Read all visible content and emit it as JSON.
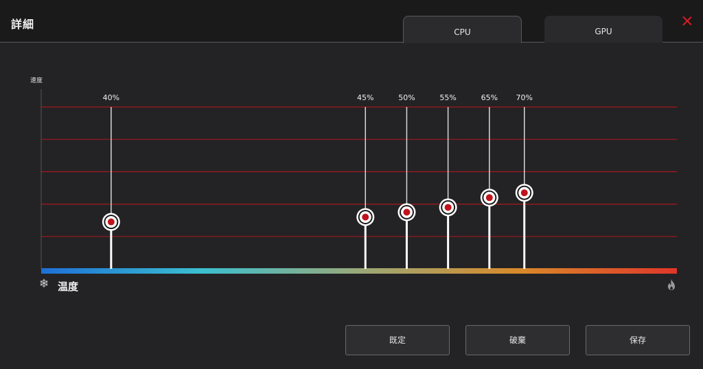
{
  "window": {
    "title": "詳細"
  },
  "tabs": [
    {
      "label": "CPU",
      "active": true
    },
    {
      "label": "GPU",
      "active": false
    }
  ],
  "chart_data": {
    "type": "line",
    "ylabel": "速度",
    "xlabel": "温度",
    "xlim": [
      0,
      100
    ],
    "ylim": [
      0,
      100
    ],
    "grid": true,
    "points": [
      {
        "label": "40%",
        "x": 11,
        "y": 29
      },
      {
        "label": "45%",
        "x": 51,
        "y": 32
      },
      {
        "label": "50%",
        "x": 57.5,
        "y": 35
      },
      {
        "label": "55%",
        "x": 64,
        "y": 38
      },
      {
        "label": "65%",
        "x": 70.5,
        "y": 44
      },
      {
        "label": "70%",
        "x": 76,
        "y": 47
      }
    ]
  },
  "colors": {
    "grid": "#a3191f",
    "accent": "#e01b24",
    "gradient": [
      "#1e6fd6",
      "#3bbfd0",
      "#9aa878",
      "#d88a2a",
      "#e0362a"
    ]
  },
  "icons": {
    "cold": "snowflake-icon",
    "hot": "flame-icon",
    "close": "close-icon"
  },
  "buttons": {
    "default": "既定",
    "discard": "破棄",
    "save": "保存"
  }
}
